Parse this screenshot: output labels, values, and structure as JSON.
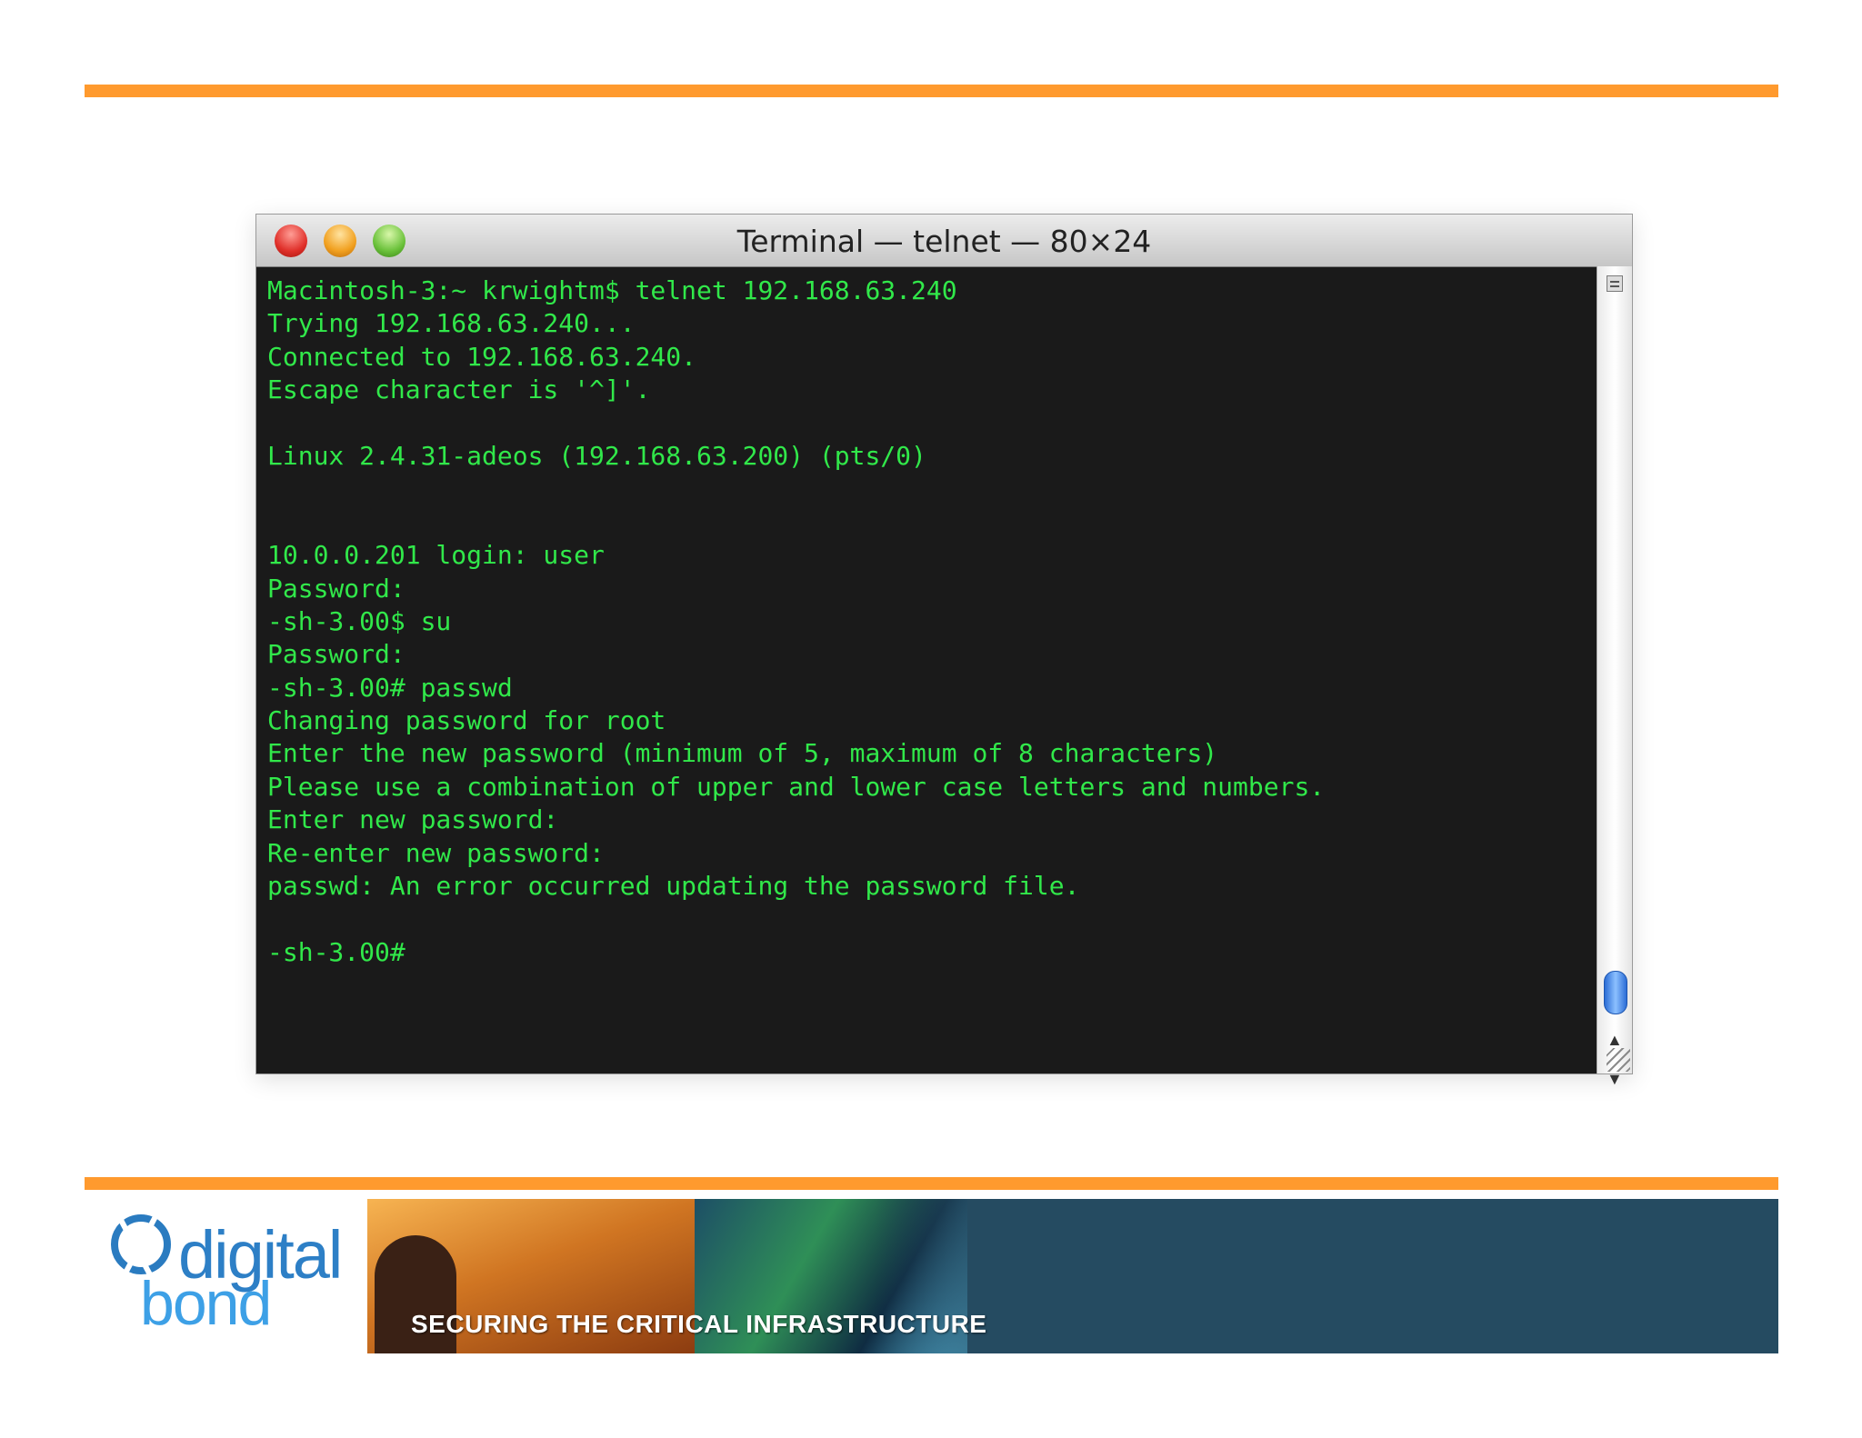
{
  "window": {
    "title": "Terminal — telnet — 80×24"
  },
  "terminal": {
    "lines": [
      "Macintosh-3:~ krwightm$ telnet 192.168.63.240",
      "Trying 192.168.63.240...",
      "Connected to 192.168.63.240.",
      "Escape character is '^]'.",
      "",
      "Linux 2.4.31-adeos (192.168.63.200) (pts/0)",
      "",
      "",
      "10.0.0.201 login: user",
      "Password:",
      "-sh-3.00$ su",
      "Password:",
      "-sh-3.00# passwd",
      "Changing password for root",
      "Enter the new password (minimum of 5, maximum of 8 characters)",
      "Please use a combination of upper and lower case letters and numbers.",
      "Enter new password:",
      "Re-enter new password:",
      "passwd: An error occurred updating the password file.",
      "",
      "-sh-3.00#"
    ]
  },
  "scrollbar": {
    "up_glyph": "▲",
    "down_glyph": "▼"
  },
  "footer": {
    "logo_line1": "digital",
    "logo_line2": "bond",
    "banner_text": "SECURING THE CRITICAL INFRASTRUCTURE"
  },
  "colors": {
    "accent_rule": "#ff9a2e",
    "terminal_bg": "#1a1a1a",
    "terminal_text": "#31e84a",
    "banner_bg": "#254b61",
    "logo_blue": "#2d7fc6"
  }
}
